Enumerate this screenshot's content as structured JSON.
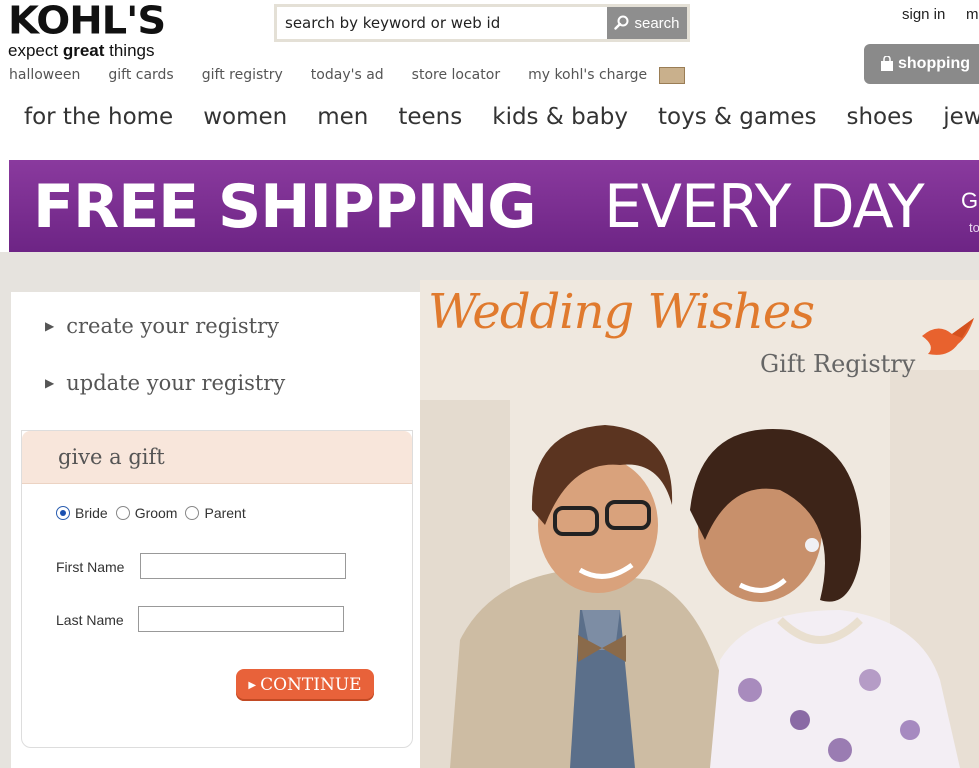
{
  "header": {
    "logo_text": "KOHL'S",
    "tagline_pre": "expect ",
    "tagline_bold": "great",
    "tagline_post": " things",
    "search": {
      "placeholder": "search by keyword or web id",
      "value": "search by keyword or web id",
      "button_label": "search"
    },
    "signin_label": "sign in",
    "signin_trailing": "m",
    "bag_label": "shopping",
    "utility_links": [
      "halloween",
      "gift cards",
      "gift registry",
      "today's ad",
      "store locator",
      "my kohl's charge"
    ],
    "categories": [
      "for the home",
      "women",
      "men",
      "teens",
      "kids & baby",
      "toys & games",
      "shoes",
      "jewel"
    ]
  },
  "banner": {
    "bold": "FREE SHIPPING",
    "light": "EVERY DAY",
    "trailing_letter": "G",
    "trailing_small": "tod"
  },
  "registry": {
    "links": [
      "create your registry",
      "update your registry"
    ],
    "give_gift": {
      "heading": "give a gift",
      "radios": [
        {
          "label": "Bride",
          "checked": true
        },
        {
          "label": "Groom",
          "checked": false
        },
        {
          "label": "Parent",
          "checked": false
        }
      ],
      "first_name_label": "First Name",
      "last_name_label": "Last Name",
      "first_name_value": "",
      "last_name_value": "",
      "continue_label": "CONTINUE"
    }
  },
  "hero": {
    "title": "Wedding Wishes",
    "subtitle": "Gift Registry"
  },
  "colors": {
    "banner_purple": "#7a2d92",
    "accent_orange": "#e07a2e",
    "continue_orange": "#e8623a"
  }
}
